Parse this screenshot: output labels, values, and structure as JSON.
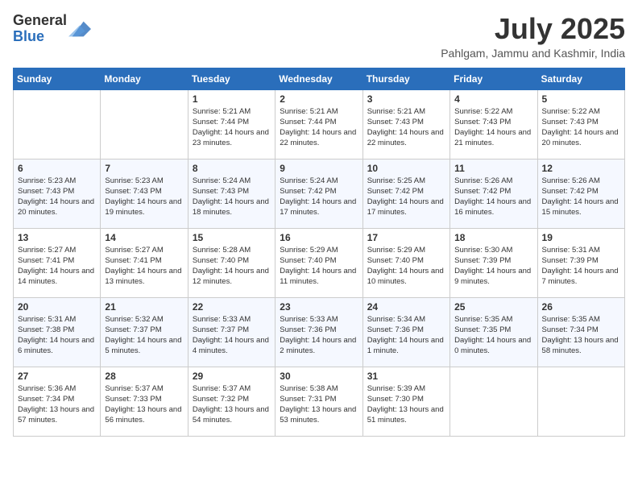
{
  "header": {
    "logo_general": "General",
    "logo_blue": "Blue",
    "month_title": "July 2025",
    "location": "Pahlgam, Jammu and Kashmir, India"
  },
  "columns": [
    "Sunday",
    "Monday",
    "Tuesday",
    "Wednesday",
    "Thursday",
    "Friday",
    "Saturday"
  ],
  "weeks": [
    [
      {
        "day": "",
        "text": ""
      },
      {
        "day": "",
        "text": ""
      },
      {
        "day": "1",
        "text": "Sunrise: 5:21 AM\nSunset: 7:44 PM\nDaylight: 14 hours and 23 minutes."
      },
      {
        "day": "2",
        "text": "Sunrise: 5:21 AM\nSunset: 7:44 PM\nDaylight: 14 hours and 22 minutes."
      },
      {
        "day": "3",
        "text": "Sunrise: 5:21 AM\nSunset: 7:43 PM\nDaylight: 14 hours and 22 minutes."
      },
      {
        "day": "4",
        "text": "Sunrise: 5:22 AM\nSunset: 7:43 PM\nDaylight: 14 hours and 21 minutes."
      },
      {
        "day": "5",
        "text": "Sunrise: 5:22 AM\nSunset: 7:43 PM\nDaylight: 14 hours and 20 minutes."
      }
    ],
    [
      {
        "day": "6",
        "text": "Sunrise: 5:23 AM\nSunset: 7:43 PM\nDaylight: 14 hours and 20 minutes."
      },
      {
        "day": "7",
        "text": "Sunrise: 5:23 AM\nSunset: 7:43 PM\nDaylight: 14 hours and 19 minutes."
      },
      {
        "day": "8",
        "text": "Sunrise: 5:24 AM\nSunset: 7:43 PM\nDaylight: 14 hours and 18 minutes."
      },
      {
        "day": "9",
        "text": "Sunrise: 5:24 AM\nSunset: 7:42 PM\nDaylight: 14 hours and 17 minutes."
      },
      {
        "day": "10",
        "text": "Sunrise: 5:25 AM\nSunset: 7:42 PM\nDaylight: 14 hours and 17 minutes."
      },
      {
        "day": "11",
        "text": "Sunrise: 5:26 AM\nSunset: 7:42 PM\nDaylight: 14 hours and 16 minutes."
      },
      {
        "day": "12",
        "text": "Sunrise: 5:26 AM\nSunset: 7:42 PM\nDaylight: 14 hours and 15 minutes."
      }
    ],
    [
      {
        "day": "13",
        "text": "Sunrise: 5:27 AM\nSunset: 7:41 PM\nDaylight: 14 hours and 14 minutes."
      },
      {
        "day": "14",
        "text": "Sunrise: 5:27 AM\nSunset: 7:41 PM\nDaylight: 14 hours and 13 minutes."
      },
      {
        "day": "15",
        "text": "Sunrise: 5:28 AM\nSunset: 7:40 PM\nDaylight: 14 hours and 12 minutes."
      },
      {
        "day": "16",
        "text": "Sunrise: 5:29 AM\nSunset: 7:40 PM\nDaylight: 14 hours and 11 minutes."
      },
      {
        "day": "17",
        "text": "Sunrise: 5:29 AM\nSunset: 7:40 PM\nDaylight: 14 hours and 10 minutes."
      },
      {
        "day": "18",
        "text": "Sunrise: 5:30 AM\nSunset: 7:39 PM\nDaylight: 14 hours and 9 minutes."
      },
      {
        "day": "19",
        "text": "Sunrise: 5:31 AM\nSunset: 7:39 PM\nDaylight: 14 hours and 7 minutes."
      }
    ],
    [
      {
        "day": "20",
        "text": "Sunrise: 5:31 AM\nSunset: 7:38 PM\nDaylight: 14 hours and 6 minutes."
      },
      {
        "day": "21",
        "text": "Sunrise: 5:32 AM\nSunset: 7:37 PM\nDaylight: 14 hours and 5 minutes."
      },
      {
        "day": "22",
        "text": "Sunrise: 5:33 AM\nSunset: 7:37 PM\nDaylight: 14 hours and 4 minutes."
      },
      {
        "day": "23",
        "text": "Sunrise: 5:33 AM\nSunset: 7:36 PM\nDaylight: 14 hours and 2 minutes."
      },
      {
        "day": "24",
        "text": "Sunrise: 5:34 AM\nSunset: 7:36 PM\nDaylight: 14 hours and 1 minute."
      },
      {
        "day": "25",
        "text": "Sunrise: 5:35 AM\nSunset: 7:35 PM\nDaylight: 14 hours and 0 minutes."
      },
      {
        "day": "26",
        "text": "Sunrise: 5:35 AM\nSunset: 7:34 PM\nDaylight: 13 hours and 58 minutes."
      }
    ],
    [
      {
        "day": "27",
        "text": "Sunrise: 5:36 AM\nSunset: 7:34 PM\nDaylight: 13 hours and 57 minutes."
      },
      {
        "day": "28",
        "text": "Sunrise: 5:37 AM\nSunset: 7:33 PM\nDaylight: 13 hours and 56 minutes."
      },
      {
        "day": "29",
        "text": "Sunrise: 5:37 AM\nSunset: 7:32 PM\nDaylight: 13 hours and 54 minutes."
      },
      {
        "day": "30",
        "text": "Sunrise: 5:38 AM\nSunset: 7:31 PM\nDaylight: 13 hours and 53 minutes."
      },
      {
        "day": "31",
        "text": "Sunrise: 5:39 AM\nSunset: 7:30 PM\nDaylight: 13 hours and 51 minutes."
      },
      {
        "day": "",
        "text": ""
      },
      {
        "day": "",
        "text": ""
      }
    ]
  ]
}
